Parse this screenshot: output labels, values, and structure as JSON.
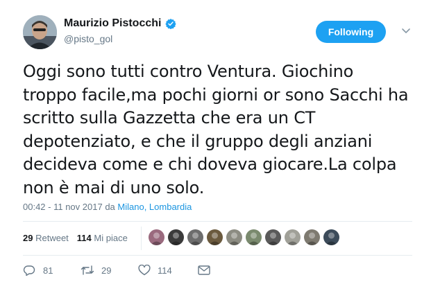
{
  "author": {
    "name": "Maurizio Pistocchi",
    "handle": "@pisto_gol",
    "verified_icon": "verified-badge-icon"
  },
  "follow_button": {
    "label": "Following"
  },
  "tweet": {
    "text": "Oggi sono tutti contro Ventura. Giochino troppo facile,ma pochi giorni or sono Sacchi ha scritto sulla Gazzetta che era un CT depotenziato, e che il gruppo degli anziani decideva come e chi doveva giocare.La colpa non è mai di uno solo."
  },
  "meta": {
    "timestamp": "00:42 - 11 nov 2017",
    "from": "da",
    "location": "Milano, Lombardia"
  },
  "stats": {
    "retweet_count": "29",
    "retweet_label": "Retweet",
    "like_count": "114",
    "like_label": "Mi piace"
  },
  "likers": [
    {
      "color": "#9a6a7e"
    },
    {
      "color": "#3b3b3b"
    },
    {
      "color": "#6d6d6d"
    },
    {
      "color": "#6b5a3e"
    },
    {
      "color": "#8c8c82"
    },
    {
      "color": "#7a8a6e"
    },
    {
      "color": "#5a5a5a"
    },
    {
      "color": "#a0a098"
    },
    {
      "color": "#7e7a70"
    },
    {
      "color": "#3c4b5a"
    }
  ],
  "actions": {
    "reply_count": "81",
    "retweet_count": "29",
    "like_count": "114"
  },
  "colors": {
    "accent": "#1da1f2",
    "link": "#1b95e0",
    "muted": "#657786",
    "text": "#14171a",
    "border": "#e6ecf0"
  }
}
